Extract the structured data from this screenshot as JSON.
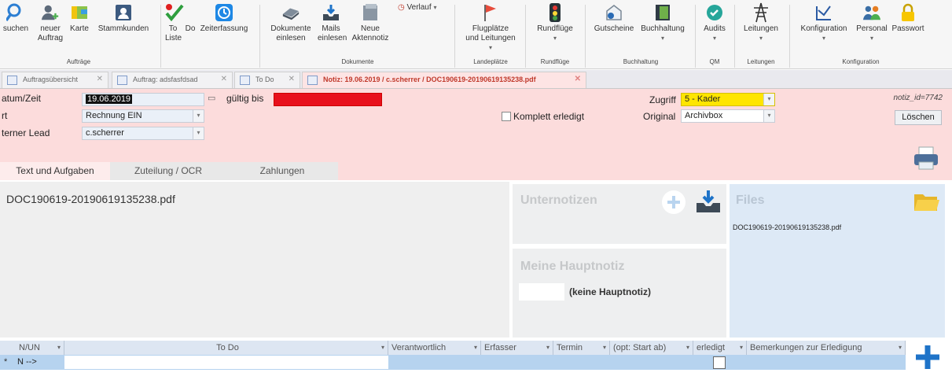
{
  "ribbon": {
    "buttons": [
      {
        "label": "suchen",
        "label2": ""
      },
      {
        "label": "neuer",
        "label2": "Auftrag"
      },
      {
        "label": "Karte",
        "label2": ""
      },
      {
        "label": "Stammkunden",
        "label2": ""
      },
      {
        "label": "To",
        "label2": "Liste"
      },
      {
        "label": "Do",
        "label2": ""
      },
      {
        "label": "Zeiterfassung",
        "label2": ""
      },
      {
        "label": "Dokumente",
        "label2": "einlesen"
      },
      {
        "label": "Mails",
        "label2": "einlesen"
      },
      {
        "label": "Neue",
        "label2": "Aktennotiz"
      },
      {
        "label": "Verlauf",
        "label2": ""
      },
      {
        "label": "Flugplätze",
        "label2": "und Leitungen"
      },
      {
        "label": "Rundflüge",
        "label2": ""
      },
      {
        "label": "Gutscheine",
        "label2": ""
      },
      {
        "label": "Buchhaltung",
        "label2": ""
      },
      {
        "label": "Audits",
        "label2": ""
      },
      {
        "label": "Leitungen",
        "label2": ""
      },
      {
        "label": "Konfiguration",
        "label2": ""
      },
      {
        "label": "Personal",
        "label2": ""
      },
      {
        "label": "Passwort",
        "label2": ""
      }
    ],
    "groups": [
      "Aufträge",
      "Dokumente",
      "Landeplätze",
      "Rundflüge",
      "Buchhaltung",
      "QM",
      "Leitungen",
      "Konfiguration"
    ]
  },
  "tabs": [
    {
      "label": "Auftragsübersicht"
    },
    {
      "label": "Auftrag: adsfasfdsad"
    },
    {
      "label": "To Do"
    },
    {
      "label": "Notiz: 19.06.2019 / c.scherrer / DOC190619-20190619135238.pdf"
    }
  ],
  "header": {
    "datum_label": "atum/Zeit",
    "datum_value": "19.06.2019",
    "gueltig_label": "gültig bis",
    "art_label": "rt",
    "art_value": "Rechnung EIN",
    "lead_label": "terner Lead",
    "lead_value": "c.scherrer",
    "komplett_label": "Komplett erledigt",
    "zugriff_label": "Zugriff",
    "zugriff_value": "5 - Kader",
    "original_label": "Original",
    "original_value": "Archivbox",
    "notiz_id": "notiz_id=7742",
    "loeschen": "Löschen"
  },
  "subtabs": [
    "Text und Aufgaben",
    "Zuteilung / OCR",
    "Zahlungen"
  ],
  "main": {
    "doc_title": "DOC190619-20190619135238.pdf",
    "unternotizen": "Unternotizen",
    "hauptnotiz_title": "Meine Hauptnotiz",
    "hauptnotiz_value": "(keine Hauptnotiz)",
    "files_title": "Files",
    "file_name": "DOC190619-20190619135238.pdf"
  },
  "grid": {
    "columns": [
      "N/UN",
      "To Do",
      "Verantwortlich",
      "Erfasser",
      "Termin",
      "(opt: Start ab)",
      "erledigt",
      "Bemerkungen zur Erledigung"
    ],
    "row_marker": "*",
    "row_value": "N -->"
  },
  "colors": {
    "header_bg": "#fcdcdc",
    "zugriff_bg": "#ffe500",
    "gueltig_bg": "#e8101c",
    "accent_blue": "#1e73c8"
  }
}
